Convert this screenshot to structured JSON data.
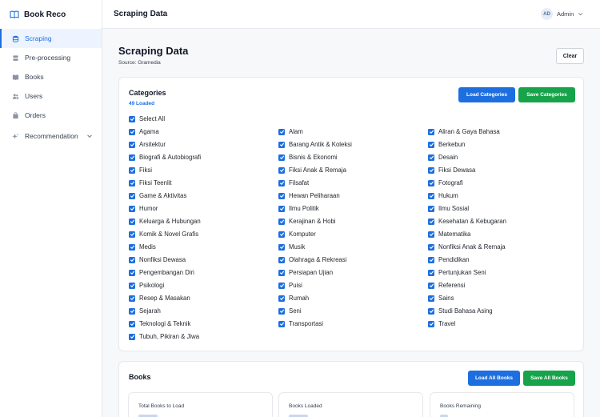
{
  "app": {
    "name": "Book Reco"
  },
  "sidebar": {
    "items": [
      {
        "label": "Scraping",
        "icon": "database-icon",
        "active": true
      },
      {
        "label": "Pre-processing",
        "icon": "layers-icon",
        "active": false
      },
      {
        "label": "Books",
        "icon": "book-icon",
        "active": false
      },
      {
        "label": "Users",
        "icon": "users-icon",
        "active": false
      },
      {
        "label": "Orders",
        "icon": "bag-icon",
        "active": false
      },
      {
        "label": "Recommendation",
        "icon": "sparkle-icon",
        "active": false
      }
    ]
  },
  "header": {
    "title": "Scraping Data",
    "avatar_initials": "AD",
    "user_name": "Admin"
  },
  "page": {
    "title": "Scraping Data",
    "source": "Source: Gramedia",
    "clear_label": "Clear"
  },
  "categories": {
    "title": "Categories",
    "loaded": "49 Loaded",
    "load_label": "Load Categories",
    "save_label": "Save Categories",
    "select_all": "Select All",
    "columns": [
      [
        "Agama",
        "Arsitektur",
        "Biografi & Autobiografi",
        "Fiksi",
        "Fiksi Teenlit",
        "Game & Aktivitas",
        "Humor",
        "Keluarga & Hubungan",
        "Komik & Novel Grafis",
        "Medis",
        "Nonfiksi Dewasa",
        "Pengembangan Diri",
        "Psikologi",
        "Resep & Masakan",
        "Sejarah",
        "Teknologi & Teknik",
        "Tubuh, Pikiran & Jiwa"
      ],
      [
        "Alam",
        "Barang Antik & Koleksi",
        "Bisnis & Ekonomi",
        "Fiksi Anak & Remaja",
        "Filsafat",
        "Hewan Peliharaan",
        "Ilmu Politik",
        "Kerajinan & Hobi",
        "Komputer",
        "Musik",
        "Olahraga & Rekreasi",
        "Persiapan Ujian",
        "Puisi",
        "Rumah",
        "Seni",
        "Transportasi"
      ],
      [
        "Aliran & Gaya Bahasa",
        "Berkebun",
        "Desain",
        "Fiksi Dewasa",
        "Fotografi",
        "Hukum",
        "Ilmu Sosial",
        "Kesehatan & Kebugaran",
        "Matematika",
        "Nonfiksi Anak & Remaja",
        "Pendidikan",
        "Pertunjukan Seni",
        "Referensi",
        "Sains",
        "Studi Bahasa Asing",
        "Travel"
      ]
    ]
  },
  "books": {
    "title": "Books",
    "load_label": "Load All Books",
    "save_label": "Save All Books",
    "stats": [
      {
        "label": "Total Books to Load"
      },
      {
        "label": "Books Loaded"
      },
      {
        "label": "Books Remaining"
      }
    ]
  },
  "colors": {
    "accent": "#1d6fe0",
    "success": "#16a34a"
  }
}
